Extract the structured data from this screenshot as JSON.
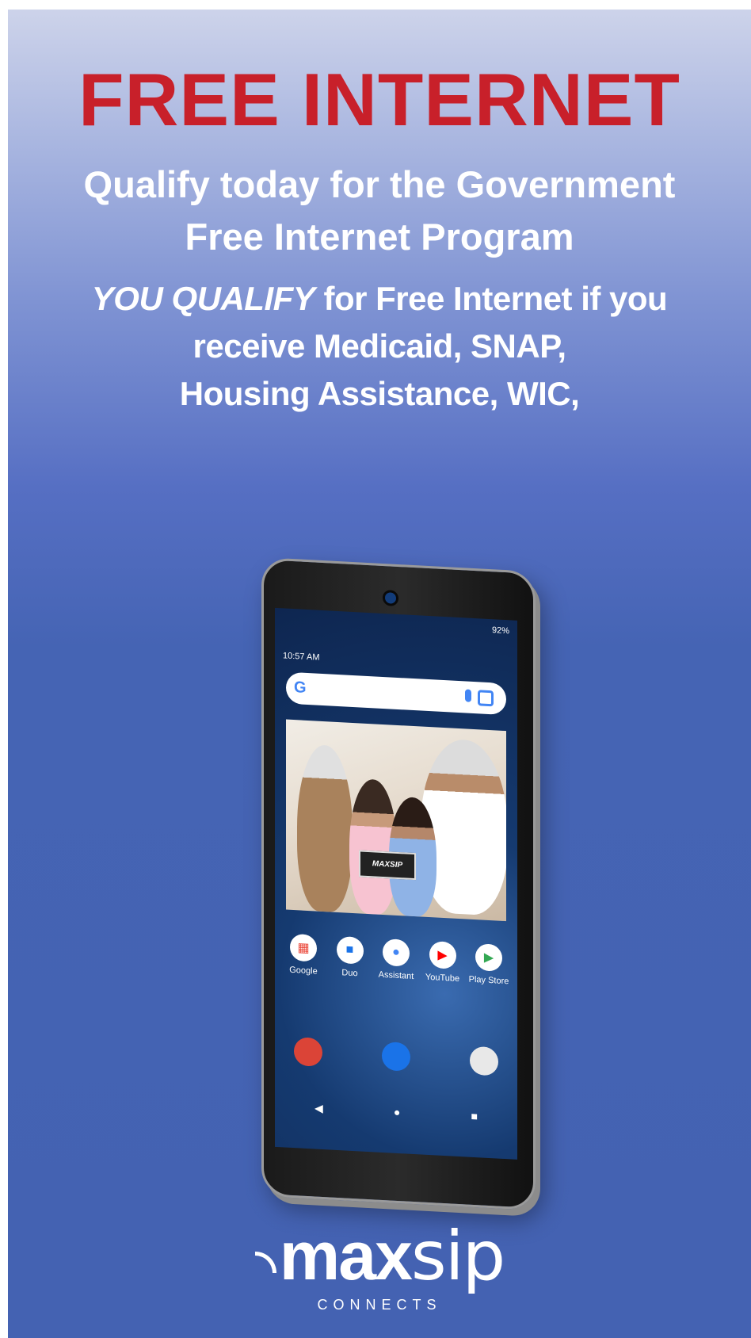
{
  "headline": "FREE INTERNET",
  "subhead": {
    "line1": "Qualify today for the Government",
    "line2": "Free Internet Program"
  },
  "qualify": {
    "emphasis": "YOU QUALIFY",
    "line1_rest": " for Free Internet if you",
    "line2": "receive Medicaid, SNAP,",
    "line3": "Housing Assistance, WIC,"
  },
  "tablet": {
    "time": "10:57 AM",
    "battery": "92%",
    "search_logo": "G",
    "mini_tablet_brand": "MAXSIP",
    "apps": [
      {
        "label": "Google",
        "icon": "google-folder-icon",
        "glyph": "▦",
        "color": "#ea4335"
      },
      {
        "label": "Duo",
        "icon": "duo-icon",
        "glyph": "■",
        "color": "#1a73e8"
      },
      {
        "label": "Assistant",
        "icon": "assistant-icon",
        "glyph": "●",
        "color": "#4285f4"
      },
      {
        "label": "YouTube",
        "icon": "youtube-icon",
        "glyph": "▶",
        "color": "#ff0000"
      },
      {
        "label": "Play Store",
        "icon": "play-store-icon",
        "glyph": "▶",
        "color": "#34a853"
      }
    ],
    "dock": [
      {
        "icon": "chrome-icon",
        "color": "#db4437"
      },
      {
        "icon": "contacts-icon",
        "color": "#1a73e8"
      },
      {
        "icon": "camera-icon",
        "color": "#e8e8e8"
      }
    ],
    "nav": {
      "back": "◀",
      "home": "●",
      "recents": "■"
    }
  },
  "logo": {
    "bold": "max",
    "thin": "sip",
    "sub": "CONNECTS"
  },
  "colors": {
    "headline": "#c8202a",
    "background": "#4462b2",
    "text": "#ffffff"
  }
}
